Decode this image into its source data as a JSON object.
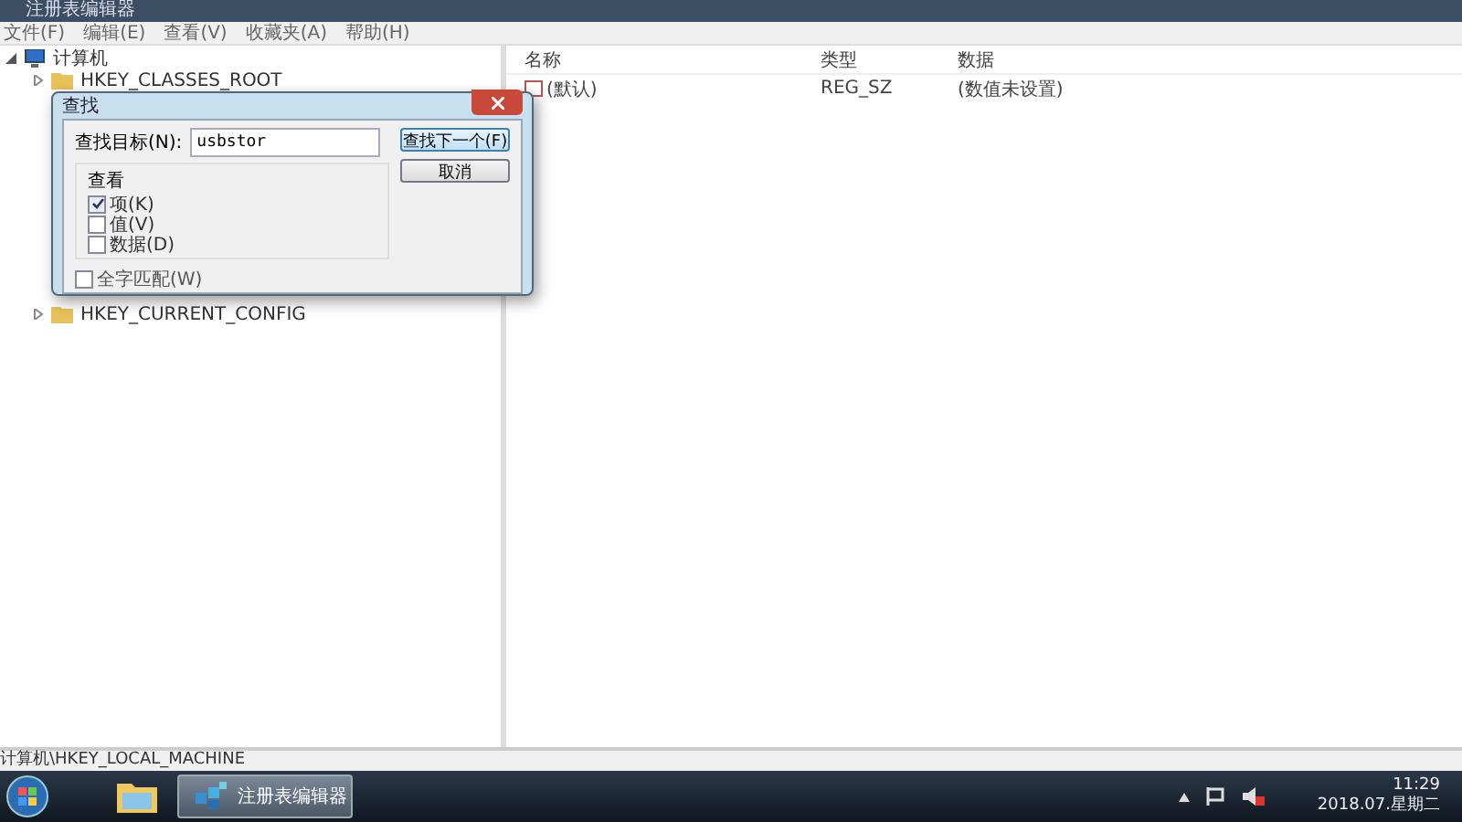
{
  "window": {
    "title": "注册表编辑器"
  },
  "menu": [
    "文件(F)",
    "编辑(E)",
    "查看(V)",
    "收藏夹(A)",
    "帮助(H)"
  ],
  "tree": {
    "label": "计算机",
    "expanded": true,
    "children": [
      {
        "label": "HKEY_CLASSES_ROOT",
        "expanded": false
      },
      {
        "label": "HKEY_CURRENT_CONFIG",
        "expanded": false
      }
    ]
  },
  "list": {
    "columns": [
      "名称",
      "类型",
      "数据"
    ],
    "rows": [
      {
        "cells": [
          "(默认)",
          "REG_SZ",
          "(数值未设置)"
        ]
      }
    ]
  },
  "dialog": {
    "title": "查找",
    "field_label": "查找目标(N):",
    "value": "usbstor",
    "buttons": [
      {
        "label": "查找下一个(F)",
        "selected": true
      },
      {
        "label": "取消",
        "selected": false
      }
    ],
    "group_title": "查看",
    "options": [
      {
        "label": "项(K)",
        "checked": true
      },
      {
        "label": "值(V)",
        "checked": false
      },
      {
        "label": "数据(D)",
        "checked": false
      }
    ],
    "whole_word": {
      "label": "全字匹配(W)",
      "checked": false
    }
  },
  "status_bar": "计算机\\HKEY_LOCAL_MACHINE",
  "taskbar": {
    "app": "注册表编辑器",
    "time": "11:29",
    "date": "2018.07.星期二"
  }
}
